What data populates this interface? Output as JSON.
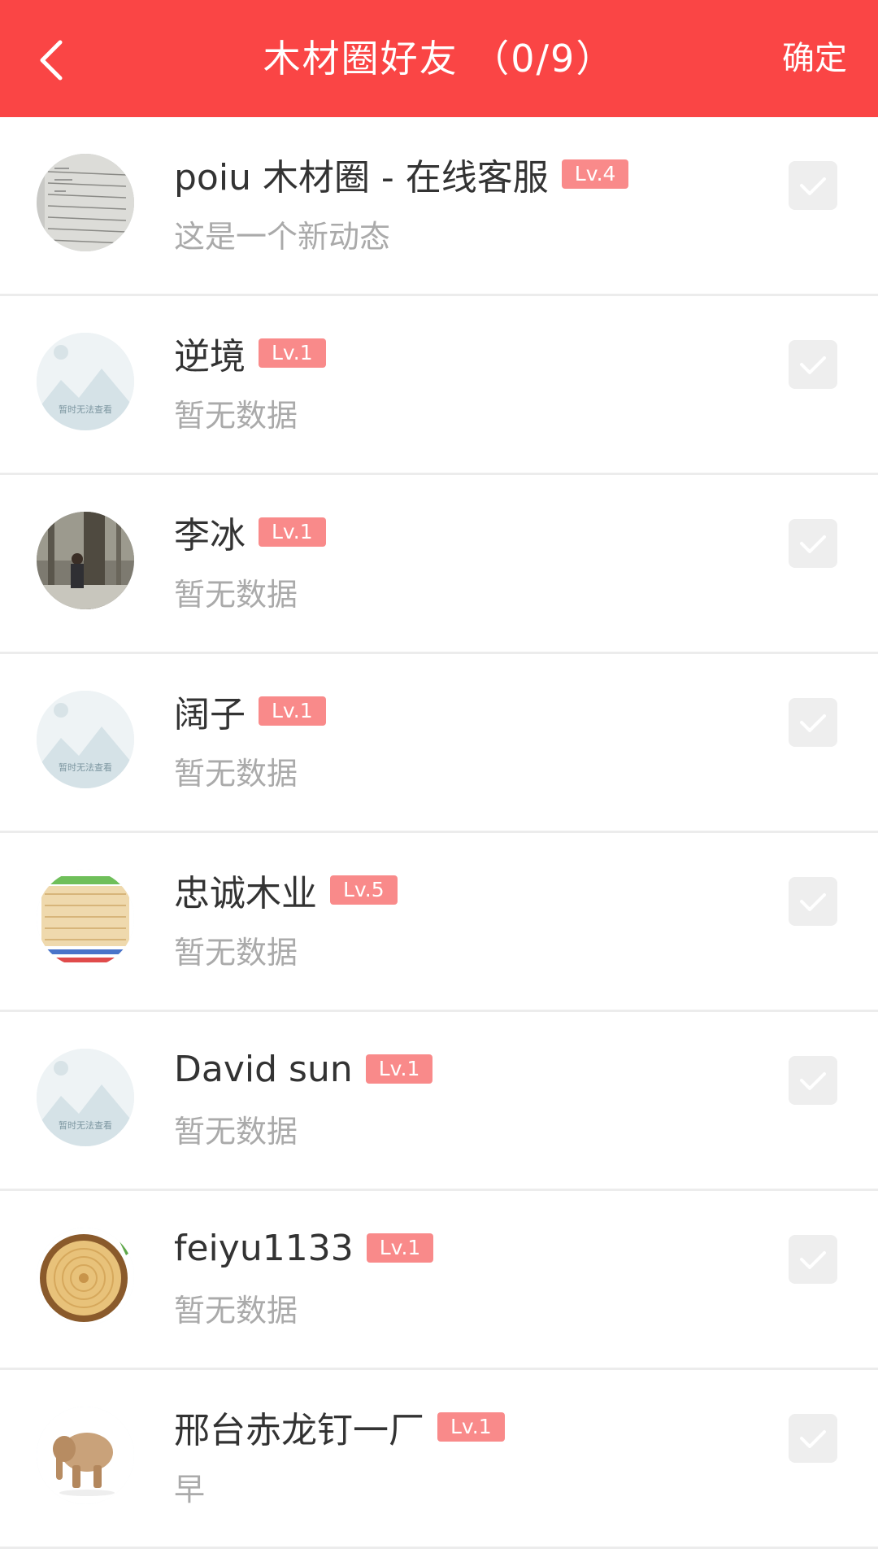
{
  "header": {
    "title": "木材圈好友 （0/9）",
    "confirm_label": "确定",
    "back_icon": "chevron-left-icon",
    "background_color": "#fa4545"
  },
  "placeholder_avatar_text": "暂时无法查看",
  "friends": [
    {
      "name": "poiu 木材圈 - 在线客服",
      "level": "Lv.4",
      "status": "这是一个新动态",
      "avatar": "notebook-photo",
      "checked": false
    },
    {
      "name": "逆境",
      "level": "Lv.1",
      "status": "暂无数据",
      "avatar": "placeholder-image",
      "checked": false
    },
    {
      "name": "李冰",
      "level": "Lv.1",
      "status": "暂无数据",
      "avatar": "person-in-forest-photo",
      "checked": false
    },
    {
      "name": "阔子",
      "level": "Lv.1",
      "status": "暂无数据",
      "avatar": "placeholder-image",
      "checked": false
    },
    {
      "name": "忠诚木业",
      "level": "Lv.5",
      "status": "暂无数据",
      "avatar": "wood-board-photo",
      "checked": false
    },
    {
      "name": "David sun",
      "level": "Lv.1",
      "status": "暂无数据",
      "avatar": "placeholder-image",
      "checked": false
    },
    {
      "name": "feiyu1133",
      "level": "Lv.1",
      "status": "暂无数据",
      "avatar": "wood-slice-photo",
      "checked": false
    },
    {
      "name": "邢台赤龙钉一厂",
      "level": "Lv.1",
      "status": "早",
      "avatar": "wooden-elephant-photo",
      "checked": false
    }
  ],
  "colors": {
    "badge": "#f98a8a",
    "name": "#333333",
    "status": "#aaaaaa",
    "checkbox": "#eeeeee"
  }
}
